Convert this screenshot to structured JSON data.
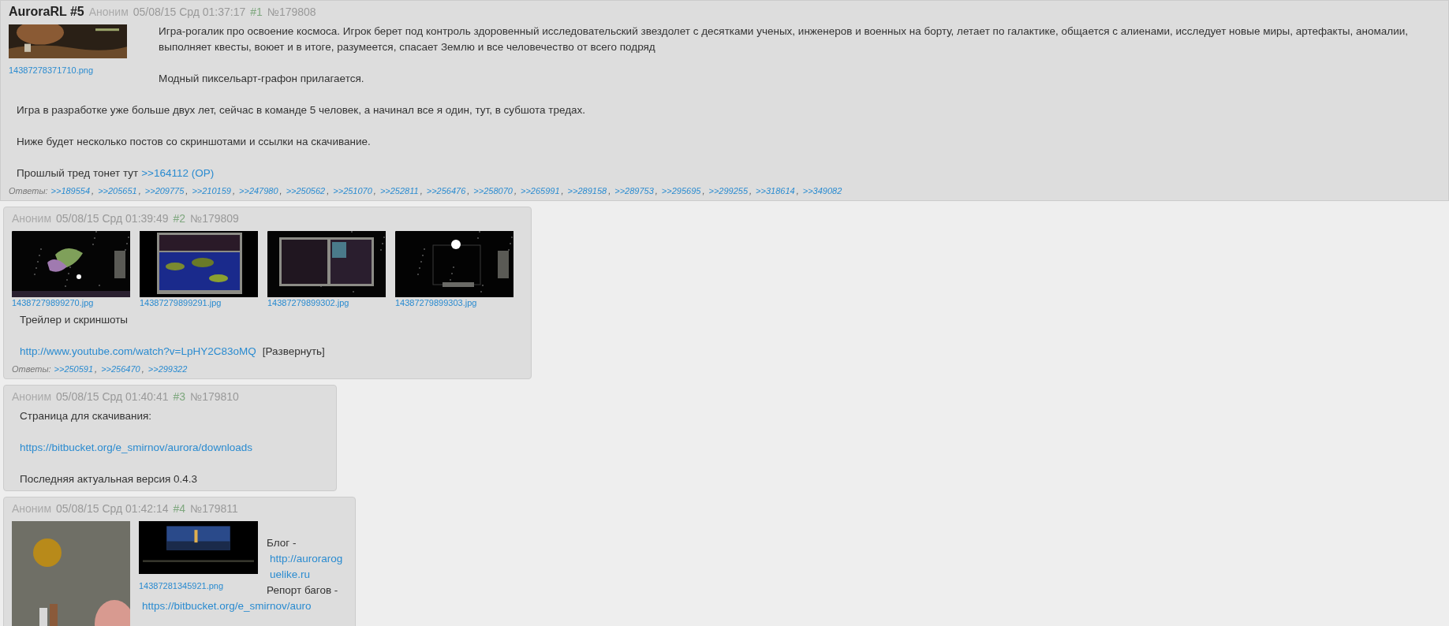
{
  "thread": [
    {
      "kind": "op",
      "subject": "AuroraRL #5",
      "name": "Аноним",
      "date": "05/08/15 Срд 01:37:17",
      "index": "#1",
      "number": "№179808",
      "images": [
        {
          "filename": "14387278371710.png"
        }
      ],
      "body": [
        [
          {
            "kind": "text",
            "text": "Игра-рогалик про освоение космоса. Игрок берет под контроль здоровенный исследовательский звездолет с десятками ученых, инженеров и военных на борту, летает по галактике, общается с алиенами, исследует новые миры, артефакты, аномалии, выполняет квесты, воюет и в итоге, разумеется, спасает Землю и все человечество от всего подряд"
          }
        ],
        [
          {
            "kind": "text",
            "text": "Модный пиксельарт-графон прилагается."
          }
        ],
        [
          {
            "kind": "text",
            "text": "Игра в разработке уже больше двух лет, сейчас в команде 5 человек, а начинал все я один, тут, в субшота тредах."
          }
        ],
        [
          {
            "kind": "text",
            "text": "Ниже будет несколько постов со скриншотами и ссылки на скачивание."
          }
        ],
        [
          {
            "kind": "text",
            "text": "Прошлый тред тонет тут"
          },
          {
            "kind": "link",
            "text": ">>164112 (OP)"
          }
        ]
      ],
      "replies": {
        "label": "Ответы:",
        "separator": ",",
        "links": [
          ">>189554",
          ">>205651",
          ">>209775",
          ">>210159",
          ">>247980",
          ">>250562",
          ">>251070",
          ">>252811",
          ">>256476",
          ">>258070",
          ">>265991",
          ">>289158",
          ">>289753",
          ">>295695",
          ">>299255",
          ">>318614",
          ">>349082"
        ]
      }
    },
    {
      "kind": "reply",
      "name": "Аноним",
      "date": "05/08/15 Срд 01:39:49",
      "index": "#2",
      "number": "№179809",
      "images": [
        {
          "filename": "14387279899270.jpg"
        },
        {
          "filename": "14387279899291.jpg"
        },
        {
          "filename": "14387279899302.jpg"
        },
        {
          "filename": "14387279899303.jpg"
        }
      ],
      "body": [
        [
          {
            "kind": "text",
            "text": "Трейлер и скриншоты"
          }
        ],
        [
          {
            "kind": "link",
            "text": "http://www.youtube.com/watch?v=LpHY2C83oMQ"
          },
          {
            "kind": "expand",
            "text": "[Развернуть]"
          }
        ]
      ],
      "replies": {
        "label": "Ответы:",
        "separator": ",",
        "links": [
          ">>250591",
          ">>256470",
          ">>299322"
        ]
      }
    },
    {
      "kind": "reply",
      "name": "Аноним",
      "date": "05/08/15 Срд 01:40:41",
      "index": "#3",
      "number": "№179810",
      "body": [
        [
          {
            "kind": "text",
            "text": "Страница для скачивания:"
          }
        ],
        [
          {
            "kind": "link",
            "text": "https://bitbucket.org/e_smirnov/aurora/downloads"
          }
        ],
        [
          {
            "kind": "text",
            "text": "Последняя актуальная версия 0.4.3"
          }
        ]
      ]
    },
    {
      "kind": "reply",
      "name": "Аноним",
      "date": "05/08/15 Срд 01:42:14",
      "index": "#4",
      "number": "№179811",
      "images": [
        {
          "kind": "tall"
        },
        {
          "filename": "14387281345921.png"
        }
      ],
      "body": [
        [
          {
            "kind": "text",
            "text": "Блог -"
          },
          {
            "kind": "link",
            "text": "http://auroraroguelike.ru"
          }
        ],
        [
          {
            "kind": "text",
            "text": "Репорт багов -"
          },
          {
            "kind": "link",
            "text": "https://bitbucket.org/e_smirnov/auro"
          }
        ]
      ]
    }
  ]
}
